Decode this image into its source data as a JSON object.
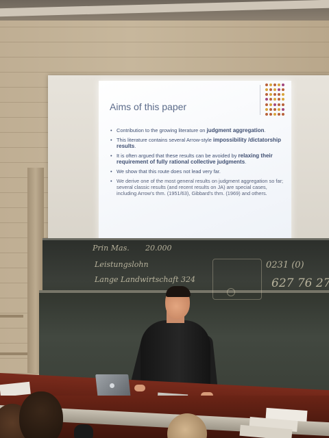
{
  "slide": {
    "title": "Aims of this paper",
    "bullets": [
      {
        "pre": "Contribution to the growing literature on ",
        "hl": "judgment aggregation",
        "post": "."
      },
      {
        "pre": "This literature contains several Arrow-style ",
        "hl": "impossibility /dictatorship results",
        "post": "."
      },
      {
        "pre": "It is often argued that these results can be avoided by ",
        "hl": "relaxing their requirement of fully rational collective judgments",
        "post": "."
      },
      {
        "pre": "We show that this route does not lead very far.",
        "hl": "",
        "post": ""
      },
      {
        "pre": "We derive one of the most general results on judgment aggregation so far; several classic results (and recent results on JA) are special cases, including Arrow's thm. (1951/63), Gibbard's thm. (1969) and others.",
        "hl": "",
        "post": ""
      }
    ]
  },
  "chalkboard": {
    "line_1a": "Prin Mas.",
    "line_1b": "20.000",
    "line_2": "Leistungslohn",
    "line_3": "Lange Landwirtschaft  324",
    "right_1": "0231 (0)",
    "right_2": "627 76 27"
  },
  "colors": {
    "slide_text": "#3f4f72",
    "slide_title": "#5b6b8a",
    "accent_dots": [
      "#b8613a",
      "#d8a43b",
      "#a2477e"
    ],
    "desk": "#6b2416",
    "chalkboard": "#3b3f39"
  }
}
